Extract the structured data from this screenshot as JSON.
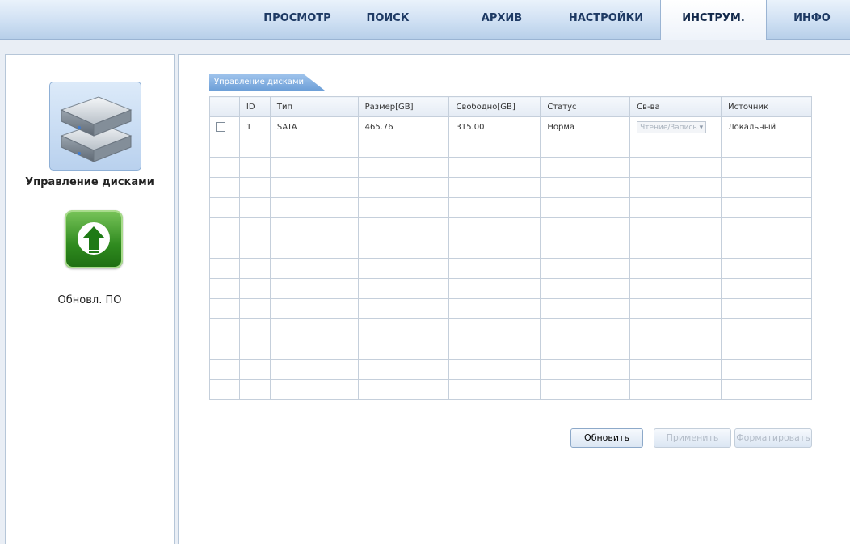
{
  "nav": {
    "tabs": [
      {
        "label": "ПРОСМОТР"
      },
      {
        "label": "ПОИСК"
      },
      {
        "label": "АРХИВ"
      },
      {
        "label": "НАСТРОЙКИ"
      },
      {
        "label": "ИНСТРУМ."
      },
      {
        "label": "ИНФО"
      }
    ],
    "active_tab": "ИНСТРУМ."
  },
  "sidebar": {
    "disk_management_label": "Управление дисками",
    "firmware_update_label": "Обновл. ПО"
  },
  "disk_panel": {
    "section_title": "Управление дисками",
    "columns": [
      "ID",
      "Тип",
      "Размер[GB]",
      "Свободно[GB]",
      "Статус",
      "Св-ва",
      "Источник"
    ],
    "rows": [
      {
        "id": "1",
        "type": "SATA",
        "size": "465.76",
        "free": "315.00",
        "status": "Норма",
        "property": "Чтение/Запись",
        "source": "Локальный"
      }
    ],
    "empty_rows": 13
  },
  "buttons": {
    "refresh": "Обновить",
    "apply": "Применить",
    "format": "Форматировать"
  },
  "colors": {
    "nav_gradient_top": "#eaf2fb",
    "nav_gradient_bottom": "#b7cfe9",
    "section_tab": "#6d9fd8",
    "upgrade_green": "#2f8a1f"
  },
  "icons": {
    "disk_management": "hdd-stack-icon",
    "firmware_update": "upload-arrow-icon",
    "dropdown": "chevron-down-icon"
  }
}
